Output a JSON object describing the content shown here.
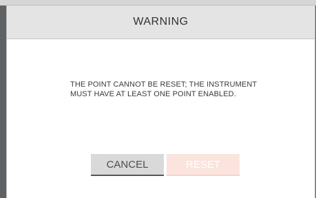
{
  "dialog": {
    "title": "WARNING",
    "message_line1": "THE POINT CANNOT BE RESET; THE INSTRUMENT",
    "message_line2": "MUST HAVE AT LEAST ONE POINT ENABLED.",
    "cancel_label": "CANCEL",
    "reset_label": "RESET",
    "reset_enabled": false
  },
  "colors": {
    "header_bg": "#e4e4e4",
    "cancel_bg": "#d9d9d9",
    "reset_bg_disabled": "#fbe4de"
  }
}
